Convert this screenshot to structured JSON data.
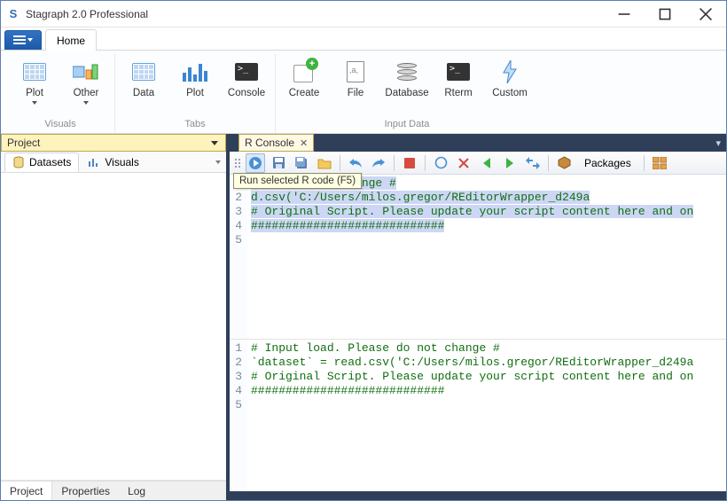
{
  "window": {
    "title": "Stagraph 2.0 Professional",
    "app_icon_letter": "S"
  },
  "main_tabs": {
    "home": "Home"
  },
  "ribbon": {
    "groups": {
      "visuals": {
        "label": "Visuals",
        "items": {
          "plot": "Plot",
          "other": "Other"
        }
      },
      "tabs": {
        "label": "Tabs",
        "items": {
          "data": "Data",
          "plot": "Plot",
          "console": "Console"
        }
      },
      "input_data": {
        "label": "Input Data",
        "items": {
          "create": "Create",
          "file": "File",
          "database": "Database",
          "rterm": "Rterm",
          "custom": "Custom"
        }
      }
    }
  },
  "project_panel": {
    "title": "Project",
    "tabs": {
      "datasets": "Datasets",
      "visuals": "Visuals"
    },
    "bottom_tabs": {
      "project": "Project",
      "properties": "Properties",
      "log": "Log"
    }
  },
  "console_panel": {
    "tab_label": "R Console",
    "tooltip": "Run selected R code (F5)",
    "packages_label": "Packages"
  },
  "code": {
    "top": {
      "lines": [
        {
          "n": "1",
          "text_a": "",
          "text_sel": "lease do not change #",
          "text_b": ""
        },
        {
          "n": "2",
          "text_a": "",
          "text_sel": "d.csv('C:/Users/milos.gregor/REditorWrapper_d249a",
          "text_b": ""
        },
        {
          "n": "3",
          "text_a": "",
          "text_sel": "# Original Script. Please update your script content here and on",
          "text_b": ""
        },
        {
          "n": "4",
          "text_a": "",
          "text_sel": "############################",
          "text_b": ""
        },
        {
          "n": "5",
          "text_a": "",
          "text_sel": "",
          "text_b": ""
        }
      ]
    },
    "bottom": {
      "lines": [
        {
          "n": "1",
          "text": "# Input load. Please do not change #"
        },
        {
          "n": "2",
          "text": "`dataset` = read.csv('C:/Users/milos.gregor/REditorWrapper_d249a"
        },
        {
          "n": "3",
          "text": "# Original Script. Please update your script content here and on"
        },
        {
          "n": "4",
          "text": "############################"
        },
        {
          "n": "5",
          "text": ""
        }
      ]
    }
  }
}
